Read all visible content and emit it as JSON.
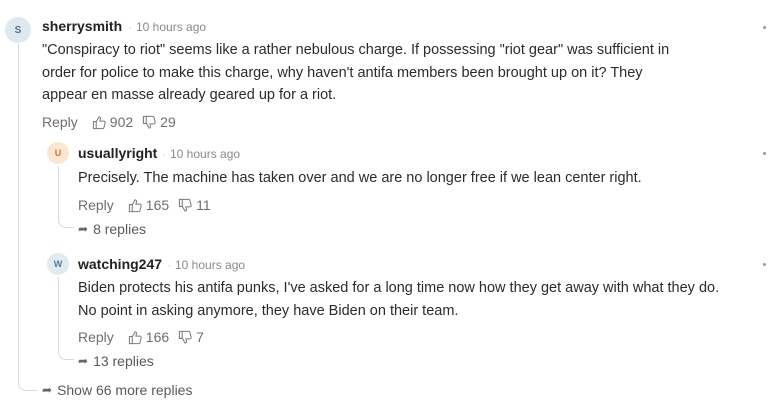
{
  "comments": {
    "top": {
      "avatar_letter": "S",
      "avatar_bg": "#dfe7ef",
      "avatar_color": "#587089",
      "username": "sherrysmith",
      "time": "10 hours ago",
      "lines": [
        "\"Conspiracy to riot\" seems like a rather nebulous charge.  If possessing \"riot gear\" was sufficient in",
        "order for police to make this charge, why haven't antifa members been brought up on it?  They",
        "appear en masse already geared up for a riot."
      ],
      "reply_label": "Reply",
      "likes": "902",
      "dislikes": "29"
    },
    "reply1": {
      "avatar_letter": "U",
      "avatar_bg": "#fbe6d2",
      "avatar_color": "#c7793b",
      "username": "usuallyright",
      "time": "10 hours ago",
      "lines": [
        "Precisely.  The machine has taken over and we are no longer free if we lean center right."
      ],
      "reply_label": "Reply",
      "likes": "165",
      "dislikes": "11",
      "replies_label": "8 replies"
    },
    "reply2": {
      "avatar_letter": "W",
      "avatar_bg": "#dfeaf1",
      "avatar_color": "#527f9c",
      "username": "watching247",
      "time": "10 hours ago",
      "lines": [
        "Biden protects his antifa punks, I've asked for a long time now how they get away with what they do.",
        "No point in asking anymore, they have Biden on their team."
      ],
      "reply_label": "Reply",
      "likes": "166",
      "dislikes": "7",
      "replies_label": "13 replies"
    },
    "show_more_label": "Show 66 more replies"
  }
}
